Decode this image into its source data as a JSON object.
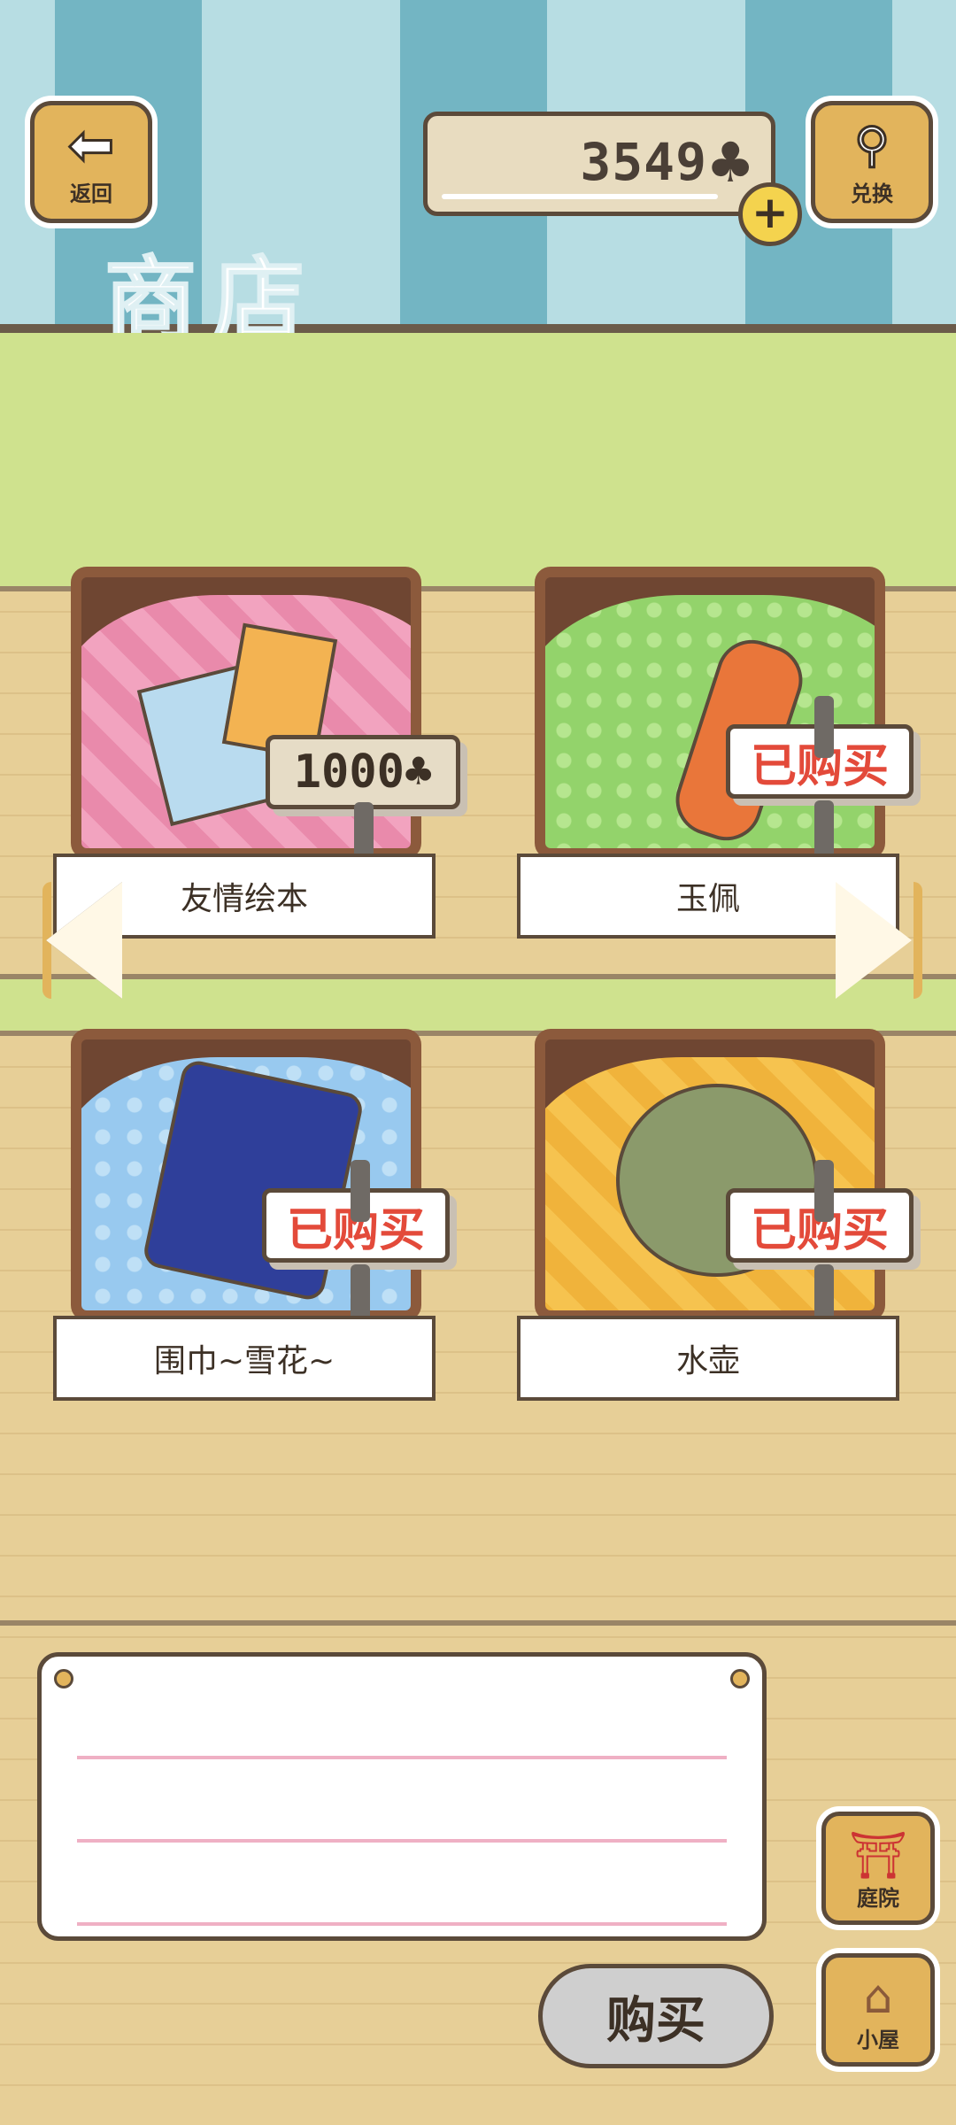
{
  "header": {
    "back_label": "返回",
    "exchange_label": "兑换",
    "currency_value": "3549",
    "currency_icon": "clover-icon",
    "plus_symbol": "+",
    "title": "商店"
  },
  "items": [
    {
      "name": "友情绘本",
      "tag": "1000",
      "tag_type": "price",
      "cloth_color": "#f2a3bf"
    },
    {
      "name": "玉佩",
      "tag": "已购买",
      "tag_type": "purchased",
      "cloth_color": "#93d36b"
    },
    {
      "name": "围巾~雪花~",
      "tag": "已购买",
      "tag_type": "purchased",
      "cloth_color": "#98c9ef"
    },
    {
      "name": "水壶",
      "tag": "已购买",
      "tag_type": "purchased",
      "cloth_color": "#f6c34f"
    }
  ],
  "buy_label": "购买",
  "nav": {
    "yard_label": "庭院",
    "house_label": "小屋"
  },
  "colors": {
    "accent_wood": "#e2b45c",
    "sold_red": "#e34a3a",
    "outline": "#5b4a3a"
  }
}
